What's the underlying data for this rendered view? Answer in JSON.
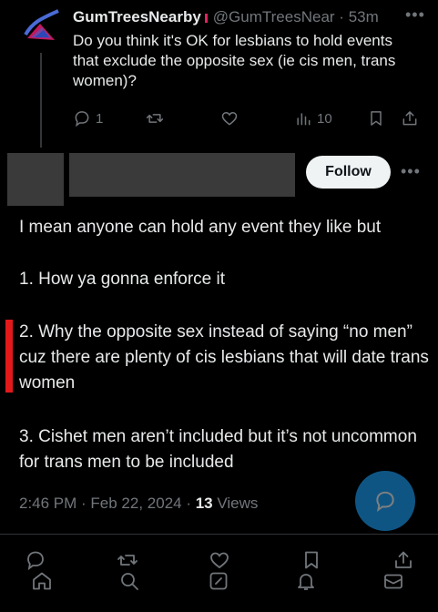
{
  "parent": {
    "display_name": "GumTreesNearby",
    "handle": "@GumTreesNear",
    "time": "53m",
    "text": "Do you think it's OK for lesbians to hold events that exclude the opposite sex (ie cis men, trans women)?",
    "replies": "1",
    "views": "10"
  },
  "reply": {
    "follow_label": "Follow",
    "paragraphs": [
      "I mean anyone can hold any event they like but",
      "1. How ya gonna enforce it",
      "2. Why the opposite sex instead of saying “no men” cuz there are plenty of cis lesbians that will date trans women",
      "3. Cishet men aren’t included but it’s not uncommon for trans men to be included"
    ],
    "timestamp": "2:46 PM · Feb 22, 2024 · ",
    "views_count": "13",
    "views_label": " Views"
  },
  "colors": {
    "accent": "#1d9bf0",
    "highlight_bar": "#e2191a"
  },
  "icons": {
    "parent_actions": [
      "reply-icon",
      "retweet-icon",
      "like-icon",
      "views-icon",
      "bookmark-icon",
      "share-icon"
    ],
    "bottom_actions": [
      "reply-icon",
      "retweet-icon",
      "like-icon",
      "bookmark-icon",
      "share-icon"
    ],
    "nav": [
      "home-icon",
      "search-icon",
      "compose-icon",
      "notifications-icon",
      "messages-icon"
    ]
  }
}
